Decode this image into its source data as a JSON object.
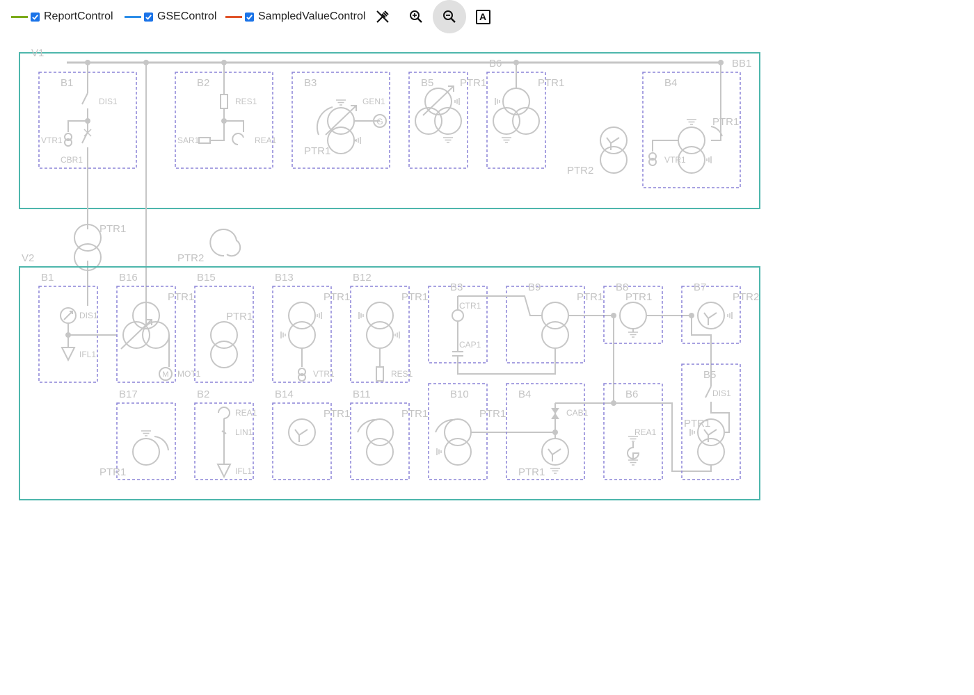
{
  "legend": [
    {
      "label": "ReportControl",
      "color": "#7cab1b",
      "checked": true
    },
    {
      "label": "GSEControl",
      "color": "#2e8ee8",
      "checked": true
    },
    {
      "label": "SampledValueControl",
      "color": "#e0542a",
      "checked": true
    }
  ],
  "toolbar": {
    "tools": [
      "snap-disable-icon",
      "zoom-in-icon",
      "zoom-out-icon",
      "label-toggle-icon"
    ],
    "active": "zoom-out-icon",
    "label_icon_text": "A"
  },
  "colors": {
    "voltage_level_border": "#4db6ac",
    "bay_border": "#8b84d7",
    "symbol": "#c6c6c6",
    "text": "#c4c4c4"
  },
  "diagram": {
    "V1": {
      "name": "V1",
      "busbar": "BB1",
      "busbar_bay": "B6",
      "bays": [
        {
          "name": "B1",
          "equipment": [
            "DIS1",
            "VTR1",
            "CBR1"
          ]
        },
        {
          "name": "B2",
          "equipment": [
            "RES1",
            "SAR1",
            "REA1"
          ]
        },
        {
          "name": "B3",
          "equipment": [
            "GEN1",
            "PTR1"
          ]
        },
        {
          "name": "B5",
          "equipment": [
            "PTR1"
          ]
        },
        {
          "name": "B6",
          "equipment": [
            "PTR1"
          ]
        },
        {
          "name": "B4",
          "equipment": [
            "PTR1",
            "VTR1"
          ]
        }
      ],
      "free_equipment": [
        "PTR2"
      ]
    },
    "between": [
      "PTR1",
      "PTR2"
    ],
    "V2": {
      "name": "V2",
      "bays": [
        {
          "name": "B1",
          "equipment": [
            "DIS1",
            "IFL1"
          ]
        },
        {
          "name": "B16",
          "equipment": [
            "PTR1",
            "MOT1"
          ]
        },
        {
          "name": "B15",
          "equipment": [
            "PTR1"
          ]
        },
        {
          "name": "B13",
          "equipment": [
            "PTR1",
            "VTR1"
          ]
        },
        {
          "name": "B12",
          "equipment": [
            "PTR1",
            "RES1"
          ]
        },
        {
          "name": "B3",
          "equipment": [
            "CTR1",
            "CAP1"
          ]
        },
        {
          "name": "B9",
          "equipment": [
            "PTR1"
          ]
        },
        {
          "name": "B8",
          "equipment": [
            "PTR1"
          ]
        },
        {
          "name": "B7",
          "equipment": [
            "PTR2"
          ]
        },
        {
          "name": "B17",
          "equipment": [
            "PTR1"
          ]
        },
        {
          "name": "B2",
          "equipment": [
            "REA1",
            "LIN1",
            "IFL1"
          ]
        },
        {
          "name": "B14",
          "equipment": [
            "PTR1"
          ]
        },
        {
          "name": "B11",
          "equipment": [
            "PTR1"
          ]
        },
        {
          "name": "B10",
          "equipment": [
            "PTR1"
          ]
        },
        {
          "name": "B4",
          "equipment": [
            "CAB1",
            "PTR1"
          ]
        },
        {
          "name": "B6",
          "equipment": [
            "REA1"
          ]
        },
        {
          "name": "B5",
          "equipment": [
            "DIS1",
            "PTR1"
          ]
        }
      ]
    }
  }
}
